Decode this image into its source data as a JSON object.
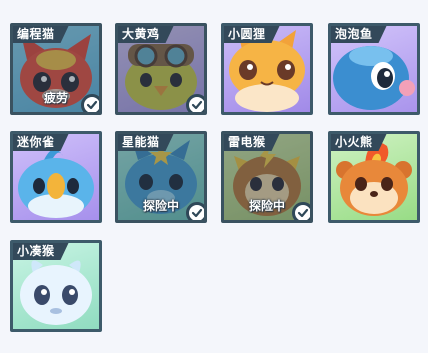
{
  "pets": [
    {
      "name": "编程猫",
      "status": "疲劳",
      "selected": true,
      "palette": "#79c9e8",
      "icon": "red-fox-cat-icon"
    },
    {
      "name": "大黄鸡",
      "status": "",
      "selected": true,
      "palette": "#c8b6f0",
      "icon": "yellow-chick-pilot-icon"
    },
    {
      "name": "小圆狸",
      "status": "",
      "selected": false,
      "palette": "#b9a6f2",
      "icon": "orange-raccoon-icon"
    },
    {
      "name": "泡泡鱼",
      "status": "",
      "selected": false,
      "palette": "#c3b2f5",
      "icon": "blue-bubble-fish-icon"
    },
    {
      "name": "迷你雀",
      "status": "",
      "selected": false,
      "palette": "#c0aff5",
      "icon": "blue-sparrow-icon"
    },
    {
      "name": "星能猫",
      "status": "探险中",
      "selected": true,
      "palette": "#8ed8d0",
      "icon": "blue-star-cat-icon"
    },
    {
      "name": "雷电猴",
      "status": "探险中",
      "selected": true,
      "palette": "#c6de9c",
      "icon": "thunder-monkey-icon"
    },
    {
      "name": "小火熊",
      "status": "",
      "selected": false,
      "palette": "#bfeab0",
      "icon": "fire-bear-icon"
    },
    {
      "name": "小凑猴",
      "status": "",
      "selected": false,
      "palette": "#b8ecd6",
      "icon": "ghost-monkey-icon"
    }
  ]
}
